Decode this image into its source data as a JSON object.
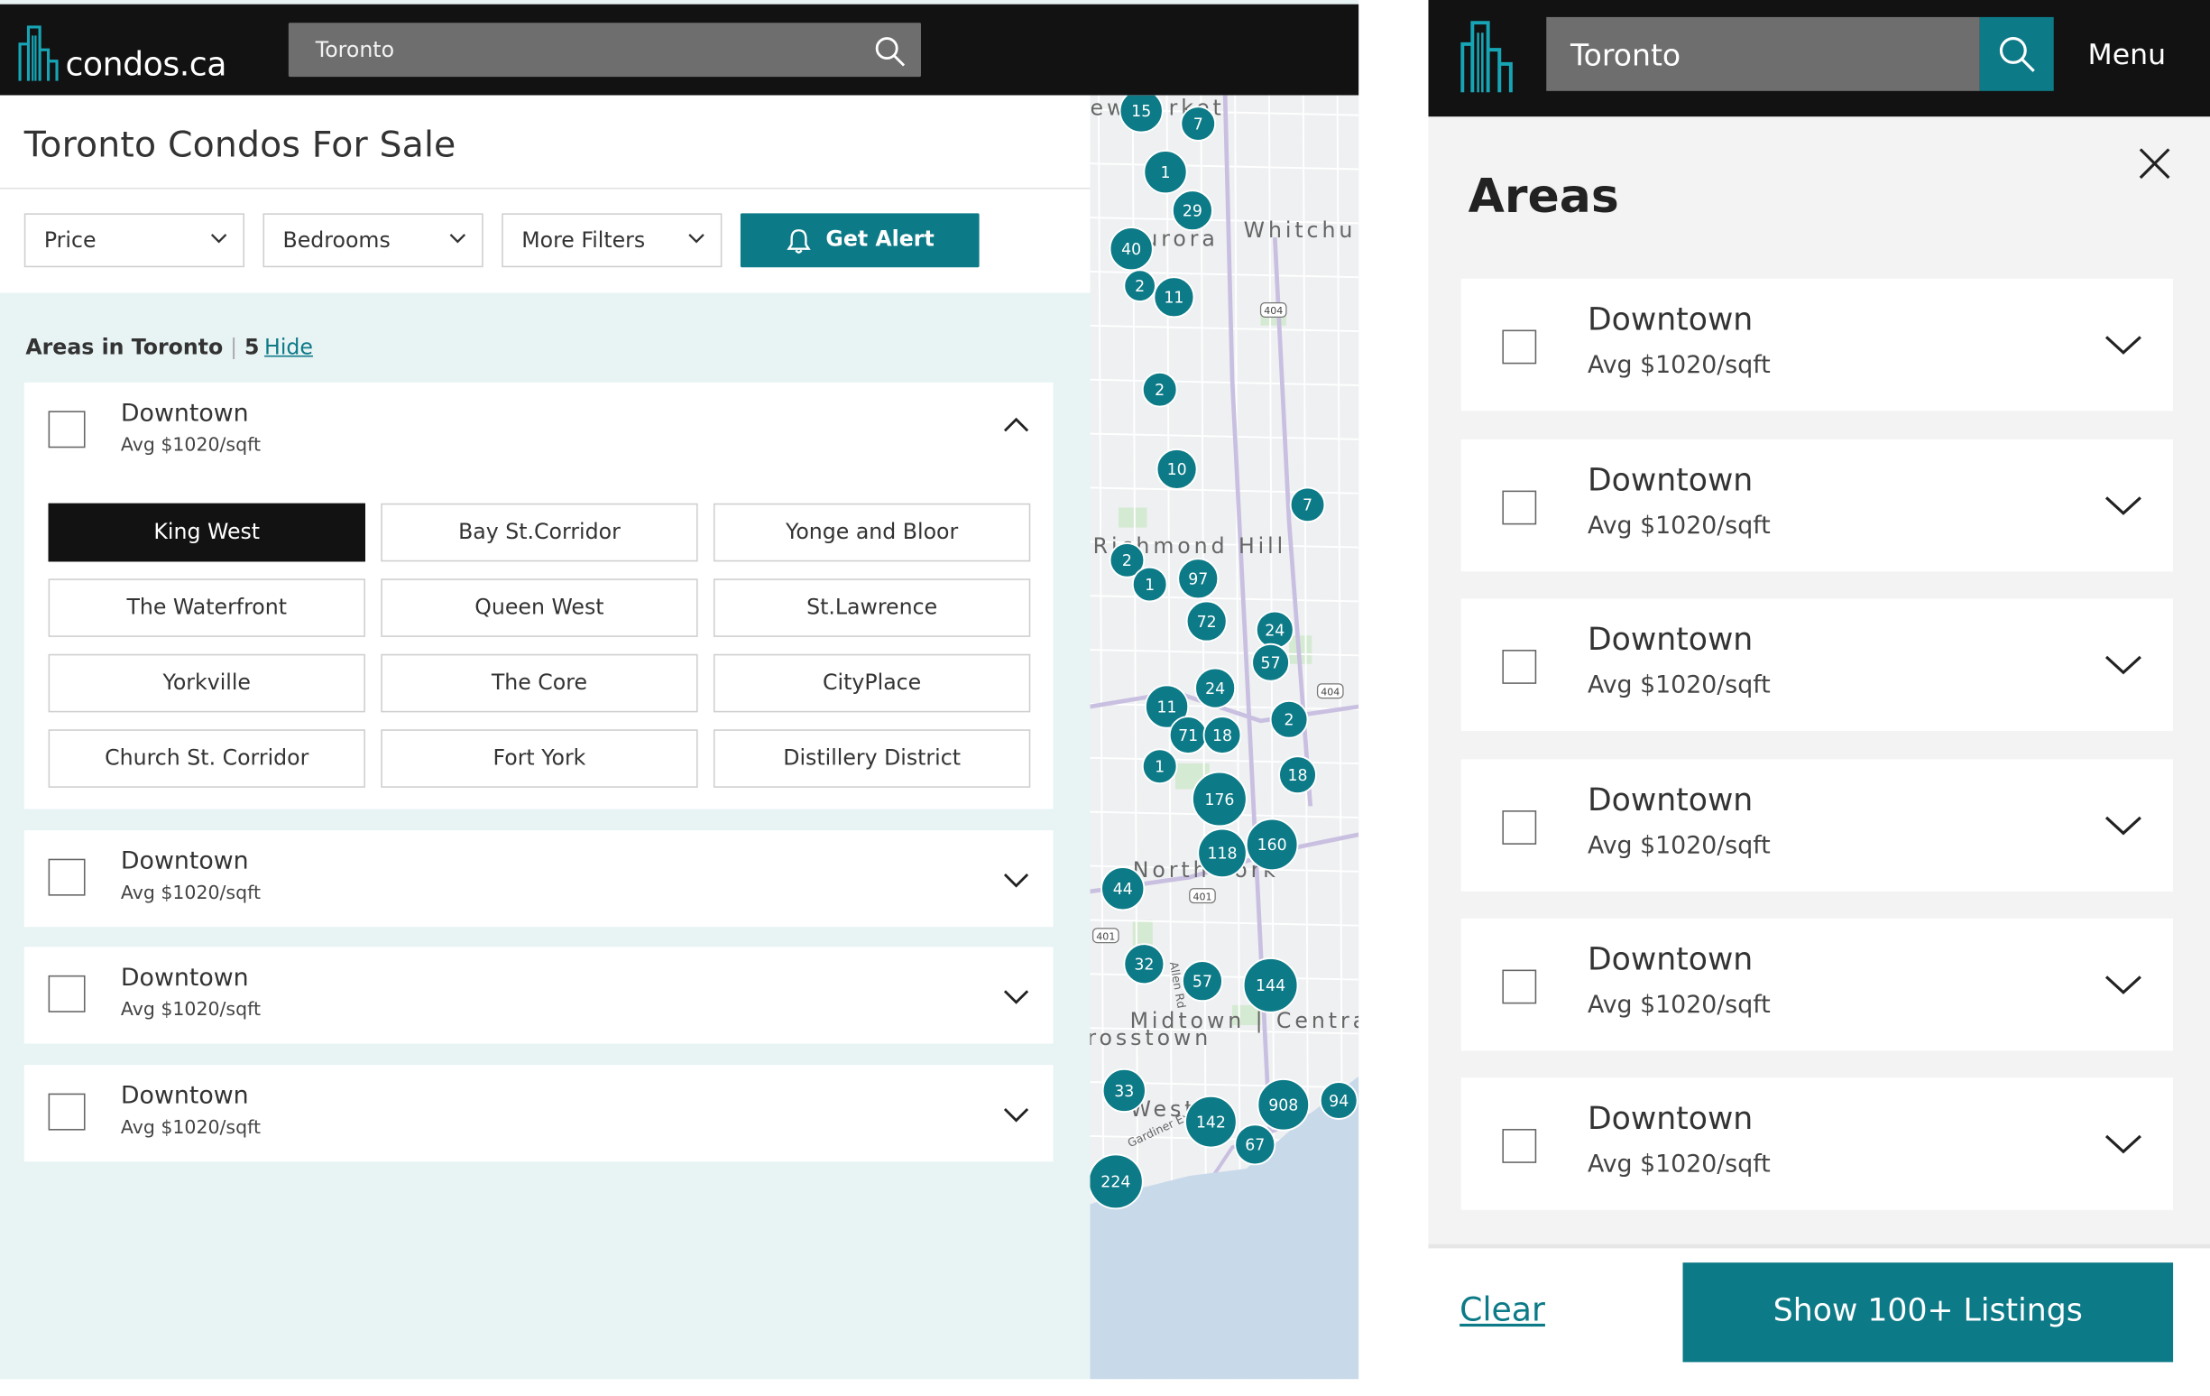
{
  "desktop": {
    "logo_text": "condos.ca",
    "search_value": "Toronto",
    "page_title": "Toronto Condos For Sale",
    "filters": [
      {
        "label": "Price"
      },
      {
        "label": "Bedrooms"
      },
      {
        "label": "More Filters"
      }
    ],
    "alert_label": "Get Alert",
    "areas_heading": "Areas in Toronto",
    "areas_count": "5",
    "hide_label": "Hide",
    "expanded_area": {
      "title": "Downtown",
      "subtitle": "Avg $1020/sqft",
      "subareas": [
        {
          "label": "King West",
          "selected": true
        },
        {
          "label": "Bay St.Corridor",
          "selected": false
        },
        {
          "label": "Yonge and Bloor",
          "selected": false
        },
        {
          "label": "The Waterfront",
          "selected": false
        },
        {
          "label": "Queen West",
          "selected": false
        },
        {
          "label": "St.Lawrence",
          "selected": false
        },
        {
          "label": "Yorkville",
          "selected": false
        },
        {
          "label": "The Core",
          "selected": false
        },
        {
          "label": "CityPlace",
          "selected": false
        },
        {
          "label": "Church St. Corridor",
          "selected": false
        },
        {
          "label": "Fort York",
          "selected": false
        },
        {
          "label": "Distillery District",
          "selected": false
        }
      ]
    },
    "collapsed_areas": [
      {
        "title": "Downtown",
        "subtitle": "Avg $1020/sqft"
      },
      {
        "title": "Downtown",
        "subtitle": "Avg $1020/sqft"
      },
      {
        "title": "Downtown",
        "subtitle": "Avg $1020/sqft"
      }
    ],
    "map": {
      "place_labels": [
        "ewmarket",
        "urora",
        "Whitchu",
        "Richmond Hill",
        "North York",
        "Midtown | Centra",
        "rosstown",
        "West",
        "Gardiner Expy",
        "Allen Rd"
      ],
      "highway_labels": [
        "404",
        "404",
        "401",
        "401"
      ],
      "clusters": [
        "15",
        "7",
        "1",
        "29",
        "40",
        "2",
        "11",
        "2",
        "10",
        "7",
        "2",
        "1",
        "97",
        "72",
        "24",
        "57",
        "11",
        "24",
        "71",
        "18",
        "2",
        "1",
        "18",
        "176",
        "160",
        "118",
        "44",
        "32",
        "57",
        "144",
        "33",
        "142",
        "908",
        "94",
        "67",
        "224"
      ]
    }
  },
  "mobile": {
    "search_value": "Toronto",
    "menu_label": "Menu",
    "panel_title": "Areas",
    "areas": [
      {
        "title": "Downtown",
        "subtitle": "Avg $1020/sqft"
      },
      {
        "title": "Downtown",
        "subtitle": "Avg $1020/sqft"
      },
      {
        "title": "Downtown",
        "subtitle": "Avg $1020/sqft"
      },
      {
        "title": "Downtown",
        "subtitle": "Avg $1020/sqft"
      },
      {
        "title": "Downtown",
        "subtitle": "Avg $1020/sqft"
      },
      {
        "title": "Downtown",
        "subtitle": "Avg $1020/sqft"
      }
    ],
    "clear_label": "Clear",
    "show_label": "Show 100+ Listings"
  },
  "colors": {
    "brand_teal": "#0c7a87",
    "header_black": "#121212",
    "panel_bg": "#e8f3f4"
  }
}
